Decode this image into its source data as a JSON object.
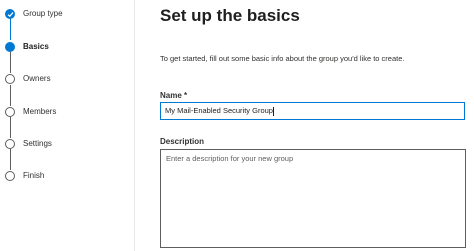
{
  "wizard": {
    "steps": [
      {
        "label": "Group type",
        "state": "completed"
      },
      {
        "label": "Basics",
        "state": "current"
      },
      {
        "label": "Owners",
        "state": "upcoming"
      },
      {
        "label": "Members",
        "state": "upcoming"
      },
      {
        "label": "Settings",
        "state": "upcoming"
      },
      {
        "label": "Finish",
        "state": "upcoming"
      }
    ]
  },
  "main": {
    "title": "Set up the basics",
    "intro": "To get started, fill out some basic info about the group you'd like to create.",
    "name_label": "Name *",
    "name_value": "My Mail-Enabled Security Group",
    "description_label": "Description",
    "description_placeholder": "Enter a description for your new group"
  },
  "colors": {
    "accent": "#0078d4",
    "text": "#323130",
    "border": "#605e5c"
  }
}
